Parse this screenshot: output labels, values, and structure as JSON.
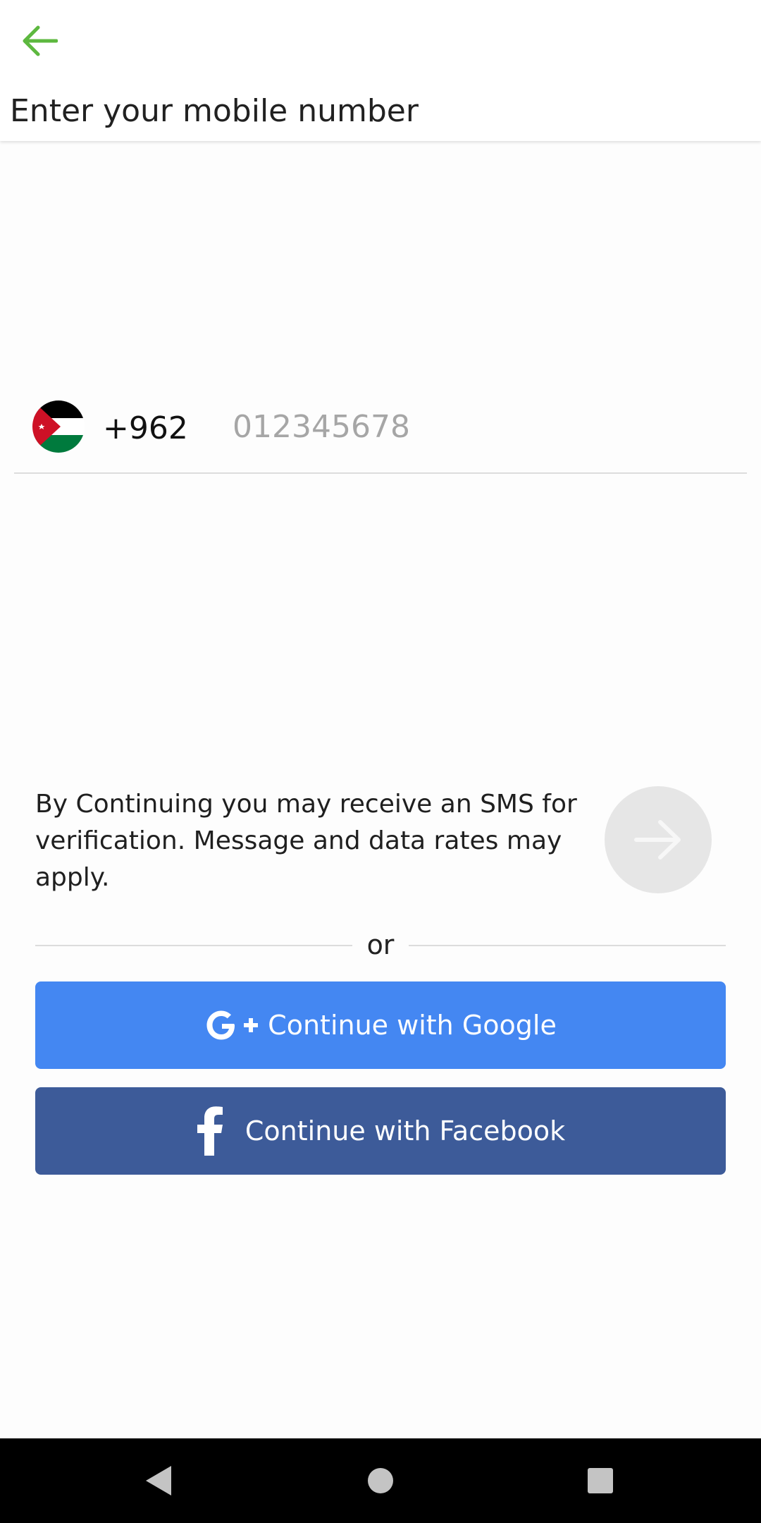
{
  "header": {
    "title": "Enter your mobile number",
    "back_icon": "arrow-left-icon",
    "accent_color": "#5db83f"
  },
  "phone": {
    "country_flag": "jordan-flag-icon",
    "dial_code": "+962",
    "number_value": "",
    "number_placeholder": "012345678"
  },
  "disclaimer": {
    "text": "By Continuing you may receive an SMS for verification. Message and data rates may apply.",
    "next_icon": "arrow-right-icon"
  },
  "divider": {
    "label": "or"
  },
  "social": {
    "google": {
      "label": "Continue with Google",
      "icon": "google-plus-icon",
      "color": "#4487f2"
    },
    "facebook": {
      "label": "Continue with Facebook",
      "icon": "facebook-icon",
      "color": "#3d5b99"
    }
  },
  "system_nav": {
    "back_icon": "nav-back-triangle-icon",
    "home_icon": "nav-home-circle-icon",
    "recents_icon": "nav-recents-square-icon"
  }
}
